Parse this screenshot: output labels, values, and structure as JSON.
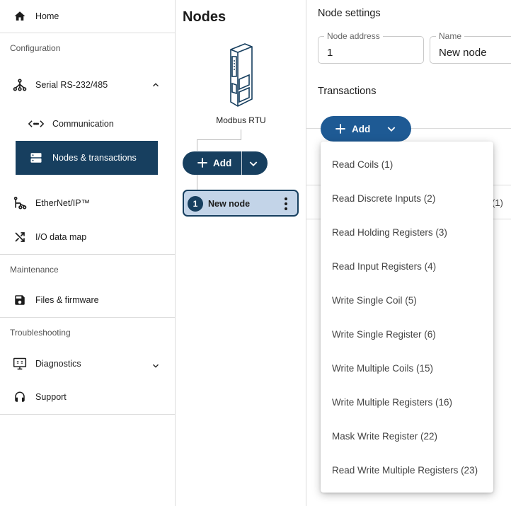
{
  "sidebar": {
    "home": "Home",
    "section_configuration": "Configuration",
    "serial": "Serial RS-232/485",
    "communication": "Communication",
    "nodes_transactions": "Nodes & transactions",
    "ethernet": "EtherNet/IP™",
    "io_data_map": "I/O data map",
    "section_maintenance": "Maintenance",
    "files_firmware": "Files & firmware",
    "section_troubleshooting": "Troubleshooting",
    "diagnostics": "Diagnostics",
    "support": "Support"
  },
  "nodes_panel": {
    "title": "Nodes",
    "device_caption": "Modbus RTU",
    "add_label": "Add",
    "node": {
      "number": "1",
      "name": "New node"
    }
  },
  "settings": {
    "title": "Node settings",
    "node_address_label": "Node address",
    "node_address_value": "1",
    "name_label": "Name",
    "name_value": "New node",
    "transactions_title": "Transactions",
    "add_label": "Add",
    "peek_text": "(1)"
  },
  "menu": {
    "items": [
      "Read Coils (1)",
      "Read Discrete Inputs (2)",
      "Read Holding Registers (3)",
      "Read Input Registers (4)",
      "Write Single Coil (5)",
      "Write Single Register (6)",
      "Write Multiple Coils (15)",
      "Write Multiple Registers (16)",
      "Mask Write Register (22)",
      "Read Write Multiple Registers (23)"
    ]
  },
  "colors": {
    "primary_dark": "#173f5f",
    "primary_button": "#1e5a94",
    "node_selected_bg": "#c3d4e8"
  },
  "icons": {
    "home": "home-icon",
    "serial": "network-tree-icon",
    "communication": "code-arrows-icon",
    "nodes": "server-icon",
    "ethernet": "ethernet-icon",
    "io_map": "shuffle-icon",
    "files": "save-icon",
    "diagnostics": "monitor-icon",
    "support": "headset-icon"
  }
}
